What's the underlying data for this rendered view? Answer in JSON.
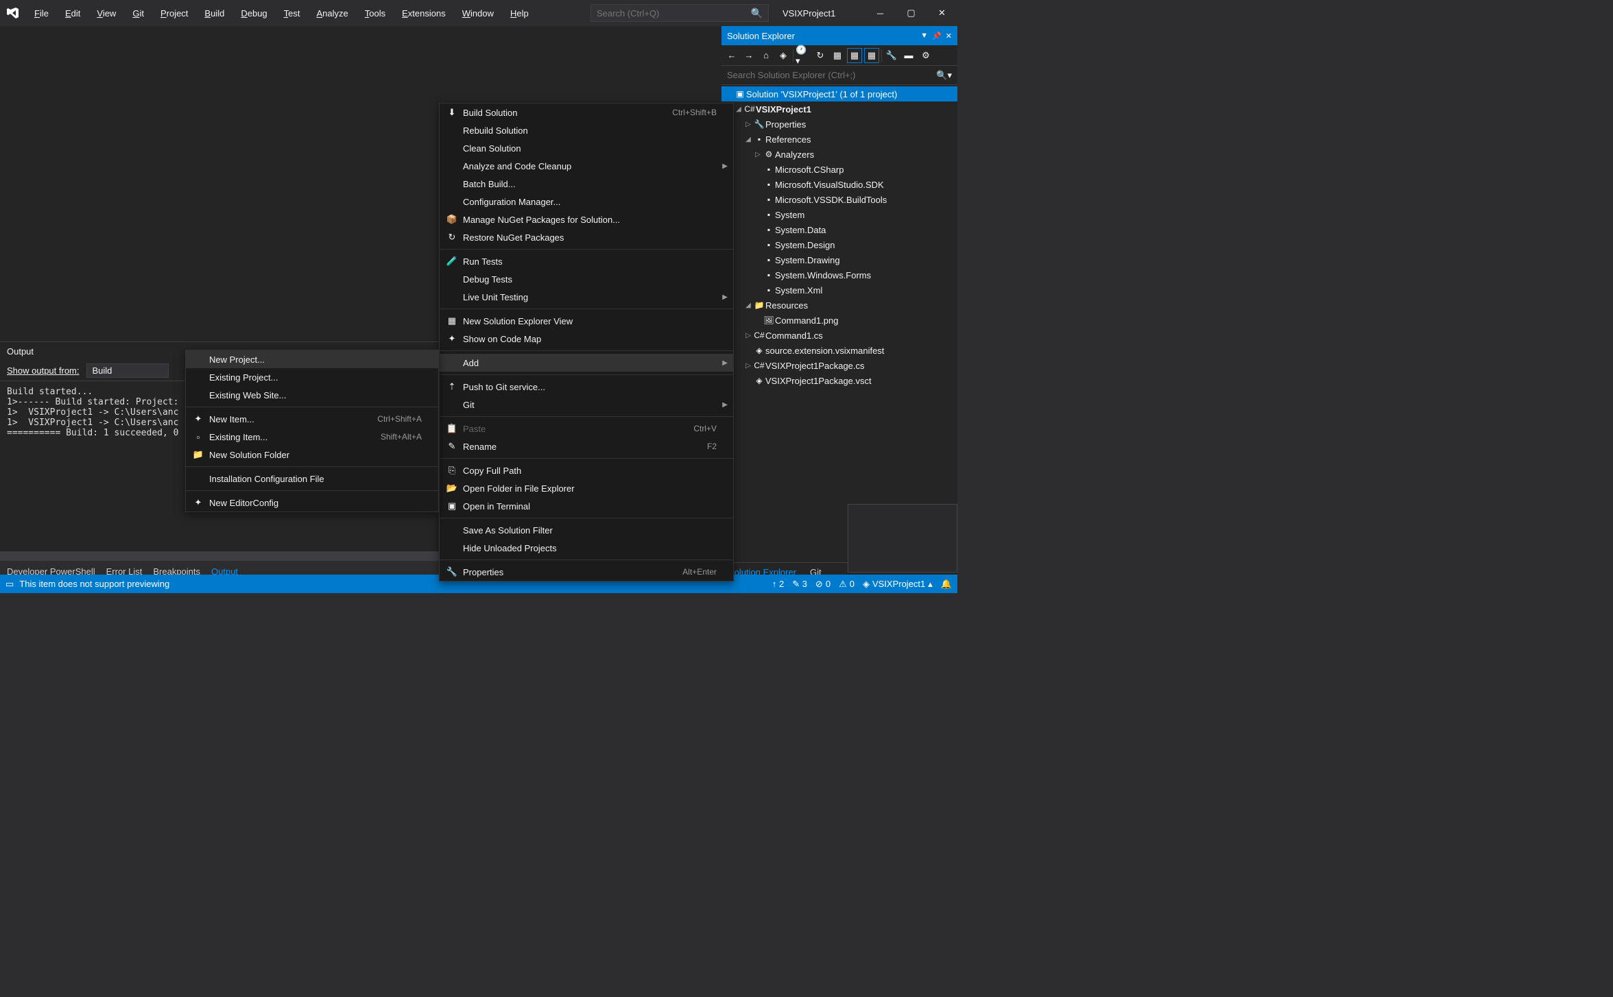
{
  "title": "VSIXProject1",
  "menu": [
    "File",
    "Edit",
    "View",
    "Git",
    "Project",
    "Build",
    "Debug",
    "Test",
    "Analyze",
    "Tools",
    "Extensions",
    "Window",
    "Help"
  ],
  "search_placeholder": "Search (Ctrl+Q)",
  "solution_explorer": {
    "title": "Solution Explorer",
    "search_placeholder": "Search Solution Explorer (Ctrl+;)",
    "root": "Solution 'VSIXProject1' (1 of 1 project)",
    "project": "VSIXProject1",
    "items": {
      "properties": "Properties",
      "references": "References",
      "analyzers": "Analyzers",
      "refs": [
        "Microsoft.CSharp",
        "Microsoft.VisualStudio.SDK",
        "Microsoft.VSSDK.BuildTools",
        "System",
        "System.Data",
        "System.Design",
        "System.Drawing",
        "System.Windows.Forms",
        "System.Xml"
      ],
      "resources": "Resources",
      "command_png": "Command1.png",
      "command_cs": "Command1.cs",
      "manifest": "source.extension.vsixmanifest",
      "pkg_cs": "VSIXProject1Package.cs",
      "pkg_vsct": "VSIXProject1Package.vsct"
    },
    "bottom_tabs": [
      "Solution Explorer",
      "Git"
    ]
  },
  "output": {
    "title": "Output",
    "show_from_label": "Show output from:",
    "show_from_value": "Build",
    "text": "Build started...\n1>------ Build started: Project:\n1>  VSIXProject1 -> C:\\Users\\anc\n1>  VSIXProject1 -> C:\\Users\\anc\n========== Build: 1 succeeded, 0"
  },
  "bottom_tabs": [
    "Developer PowerShell",
    "Error List",
    "Breakpoints",
    "Output"
  ],
  "ctx_main": [
    {
      "type": "item",
      "icon": "⬇",
      "label": "Build Solution",
      "shortcut": "Ctrl+Shift+B"
    },
    {
      "type": "item",
      "label": "Rebuild Solution"
    },
    {
      "type": "item",
      "label": "Clean Solution"
    },
    {
      "type": "item",
      "label": "Analyze and Code Cleanup",
      "arrow": true
    },
    {
      "type": "item",
      "label": "Batch Build..."
    },
    {
      "type": "item",
      "label": "Configuration Manager..."
    },
    {
      "type": "item",
      "icon": "📦",
      "label": "Manage NuGet Packages for Solution..."
    },
    {
      "type": "item",
      "icon": "↻",
      "label": "Restore NuGet Packages"
    },
    {
      "type": "sep"
    },
    {
      "type": "item",
      "icon": "🧪",
      "label": "Run Tests"
    },
    {
      "type": "item",
      "label": "Debug Tests"
    },
    {
      "type": "item",
      "label": "Live Unit Testing",
      "arrow": true
    },
    {
      "type": "sep"
    },
    {
      "type": "item",
      "icon": "▦",
      "label": "New Solution Explorer View"
    },
    {
      "type": "item",
      "icon": "✦",
      "label": "Show on Code Map"
    },
    {
      "type": "sep"
    },
    {
      "type": "item",
      "label": "Add",
      "arrow": true,
      "hover": true
    },
    {
      "type": "sep"
    },
    {
      "type": "item",
      "icon": "⇡",
      "label": "Push to Git service..."
    },
    {
      "type": "item",
      "label": "Git",
      "arrow": true
    },
    {
      "type": "sep"
    },
    {
      "type": "item",
      "icon": "📋",
      "label": "Paste",
      "shortcut": "Ctrl+V",
      "disabled": true
    },
    {
      "type": "item",
      "icon": "✎",
      "label": "Rename",
      "shortcut": "F2"
    },
    {
      "type": "sep"
    },
    {
      "type": "item",
      "icon": "⎘",
      "label": "Copy Full Path"
    },
    {
      "type": "item",
      "icon": "📂",
      "label": "Open Folder in File Explorer"
    },
    {
      "type": "item",
      "icon": "▣",
      "label": "Open in Terminal"
    },
    {
      "type": "sep"
    },
    {
      "type": "item",
      "label": "Save As Solution Filter"
    },
    {
      "type": "item",
      "label": "Hide Unloaded Projects"
    },
    {
      "type": "sep"
    },
    {
      "type": "item",
      "icon": "🔧",
      "label": "Properties",
      "shortcut": "Alt+Enter"
    }
  ],
  "ctx_sub": [
    {
      "type": "item",
      "label": "New Project...",
      "hover": true
    },
    {
      "type": "item",
      "label": "Existing Project..."
    },
    {
      "type": "item",
      "label": "Existing Web Site..."
    },
    {
      "type": "sep"
    },
    {
      "type": "item",
      "icon": "✦",
      "label": "New Item...",
      "shortcut": "Ctrl+Shift+A"
    },
    {
      "type": "item",
      "icon": "▫",
      "label": "Existing Item...",
      "shortcut": "Shift+Alt+A"
    },
    {
      "type": "item",
      "icon": "📁",
      "label": "New Solution Folder"
    },
    {
      "type": "sep"
    },
    {
      "type": "item",
      "label": "Installation Configuration File"
    },
    {
      "type": "sep"
    },
    {
      "type": "item",
      "icon": "✦",
      "label": "New EditorConfig"
    }
  ],
  "statusbar": {
    "msg": "This item does not support previewing",
    "changes": "↑ 2",
    "pending": "✎ 3",
    "errors": "0",
    "warnings": "0",
    "project": "VSIXProject1"
  }
}
